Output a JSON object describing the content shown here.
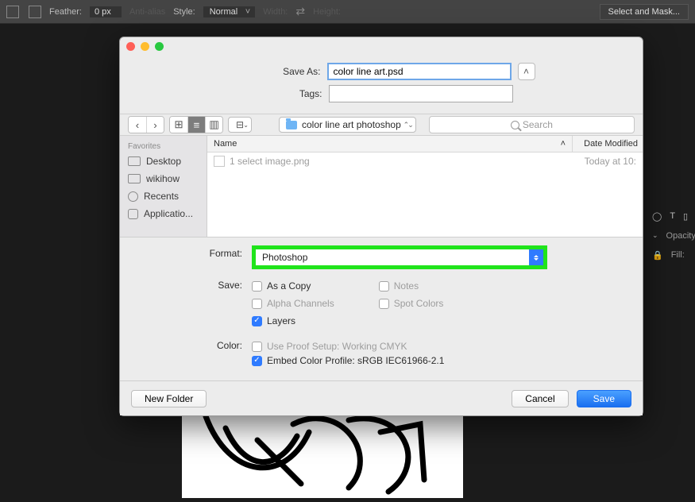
{
  "ps_options_bar": {
    "feather_label": "Feather:",
    "feather_value": "0 px",
    "antialias_label": "Anti-alias",
    "style_label": "Style:",
    "style_value": "Normal",
    "width_label": "Width:",
    "height_label": "Height:",
    "select_mask": "Select and Mask..."
  },
  "ps_right_panel": {
    "opacity_label": "Opacity:",
    "fill_label": "Fill:"
  },
  "dialog": {
    "save_as_label": "Save As:",
    "save_as_value": "color line art.psd",
    "tags_label": "Tags:",
    "tags_value": "",
    "path_popup": "color line art photoshop",
    "search_placeholder": "Search",
    "sidebar": {
      "header": "Favorites",
      "items": [
        "Desktop",
        "wikihow",
        "Recents",
        "Applicatio..."
      ]
    },
    "columns": {
      "name": "Name",
      "date": "Date Modified"
    },
    "files": [
      {
        "name": "1 select image.png",
        "date": "Today at 10:"
      }
    ],
    "format_label": "Format:",
    "format_value": "Photoshop",
    "save_label": "Save:",
    "save_opts": {
      "as_copy": "As a Copy",
      "notes": "Notes",
      "alpha": "Alpha Channels",
      "spot": "Spot Colors",
      "layers": "Layers"
    },
    "color_label": "Color:",
    "color_opts": {
      "proof": "Use Proof Setup:  Working CMYK",
      "embed": "Embed Color Profile:  sRGB IEC61966-2.1"
    },
    "new_folder": "New Folder",
    "cancel": "Cancel",
    "save_btn": "Save"
  }
}
